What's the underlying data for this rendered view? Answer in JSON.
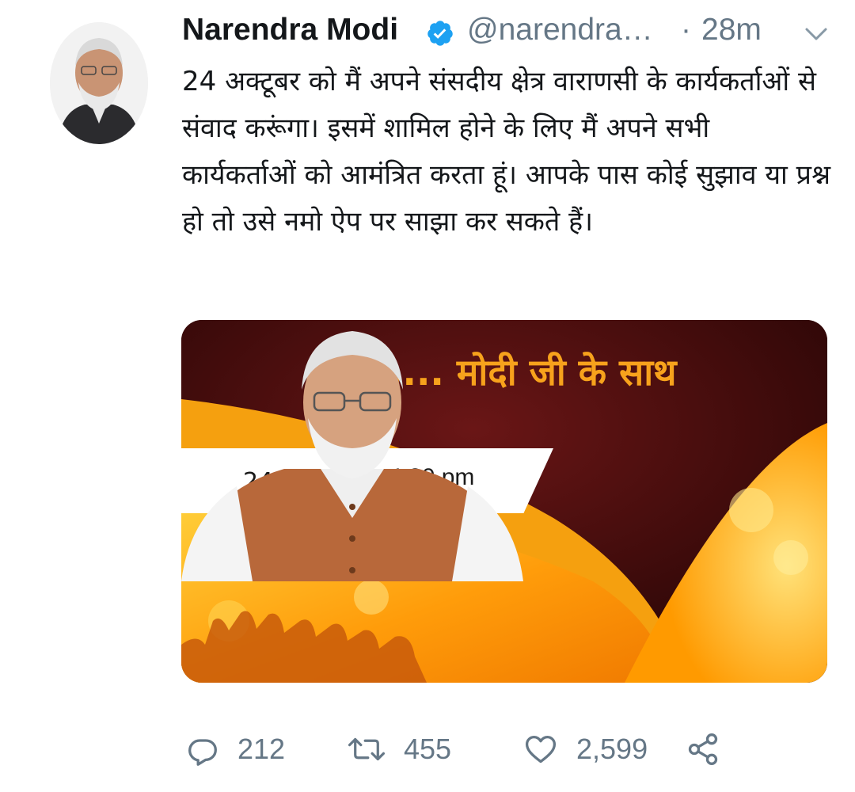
{
  "tweet": {
    "author_name": "Narendra Modi",
    "handle": "@narendra…",
    "separator": "·",
    "time": "28m",
    "text": "24 अक्टूबर को मैं अपने संसदीय क्षेत्र वाराणसी के कार्यकर्ताओं से संवाद करूंगा। इसमें शामिल होने के लिए मैं अपने सभी कार्यकर्ताओं को आमंत्रित करता हूं। आपके पास कोई सुझाव या प्रश्न हो तो उसे नमो ऐप पर साझा कर सकते हैं।"
  },
  "media": {
    "banner_title": ".... मोदी जी के साथ",
    "date": "24 अक्टूबर",
    "time": "4.30 pm"
  },
  "actions": {
    "replies": "212",
    "retweets": "455",
    "likes": "2,599"
  },
  "icons": {
    "verified": "verified-badge-icon",
    "menu": "chevron-down-icon",
    "reply": "reply-icon",
    "retweet": "retweet-icon",
    "like": "heart-icon",
    "share": "share-icon"
  },
  "colors": {
    "text": "#14171a",
    "muted": "#657786",
    "verified": "#1da1f2",
    "banner_gold": "#f7a21c",
    "banner_dark": "#3a0a0c",
    "banner_orange": "#ff9c0a"
  }
}
